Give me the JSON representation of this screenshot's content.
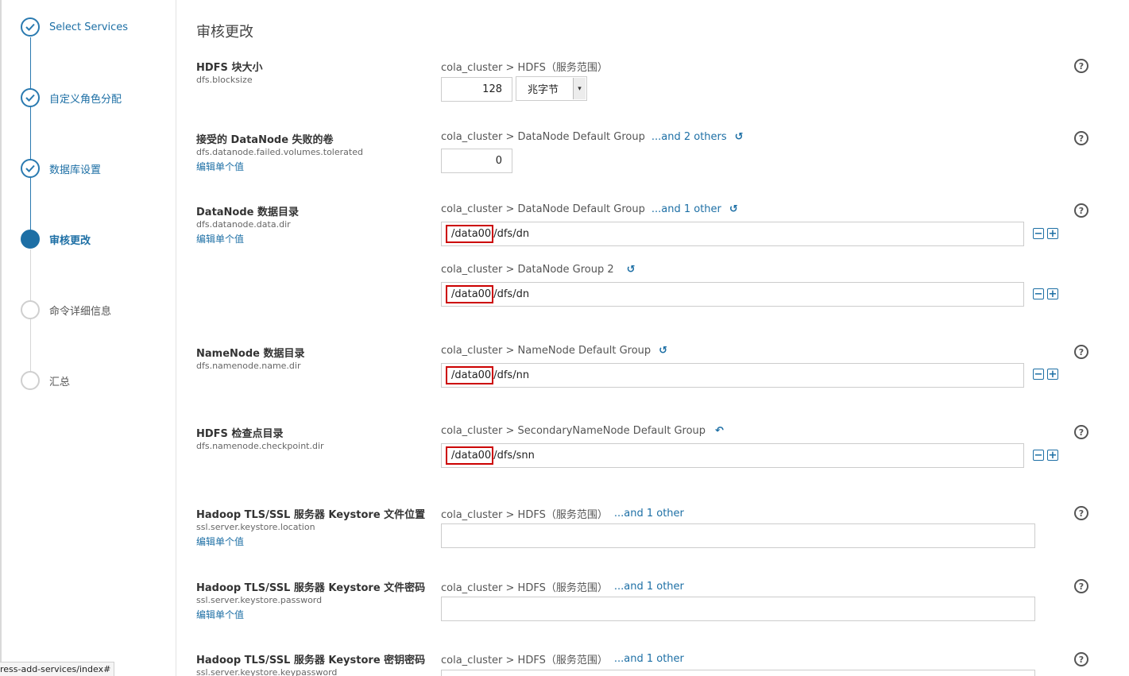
{
  "steps": [
    {
      "label": "Select Services",
      "state": "done"
    },
    {
      "label": "自定义角色分配",
      "state": "done"
    },
    {
      "label": "数据库设置",
      "state": "done"
    },
    {
      "label": "审核更改",
      "state": "active"
    },
    {
      "label": "命令详细信息",
      "state": "todo"
    },
    {
      "label": "汇总",
      "state": "todo"
    }
  ],
  "url_tip": "ress-add-services/index#",
  "page_title": "审核更改",
  "edit_label": "编辑单个值",
  "undo_icon": "↺",
  "revert_icon": "↶",
  "help_icon": "?",
  "minus_icon": "−",
  "plus_icon": "+",
  "caret_icon": "▾",
  "props": {
    "blocksize": {
      "name": "HDFS 块大小",
      "key": "dfs.blocksize",
      "scope": "cola_cluster > HDFS（服务范围）",
      "value": "128",
      "unit": "兆字节"
    },
    "failed_volumes": {
      "name": "接受的 DataNode 失败的卷",
      "key": "dfs.datanode.failed.volumes.tolerated",
      "scope": "cola_cluster > DataNode Default Group",
      "others": "...and 2 others",
      "value": "0"
    },
    "data_dir": {
      "name": "DataNode 数据目录",
      "key": "dfs.datanode.data.dir",
      "scope1": "cola_cluster > DataNode Default Group",
      "others1": "...and 1 other",
      "prefix1": "/data00",
      "rest1": "/dfs/dn",
      "scope2": "cola_cluster > DataNode Group 2",
      "prefix2": "/data00",
      "rest2": "/dfs/dn"
    },
    "name_dir": {
      "name": "NameNode 数据目录",
      "key": "dfs.namenode.name.dir",
      "scope": "cola_cluster > NameNode Default Group",
      "prefix": "/data00",
      "rest": "/dfs/nn"
    },
    "checkpoint_dir": {
      "name": "HDFS 检查点目录",
      "key": "dfs.namenode.checkpoint.dir",
      "scope": "cola_cluster > SecondaryNameNode Default Group",
      "prefix": "/data00",
      "rest": "/dfs/snn"
    },
    "keystore_location": {
      "name": "Hadoop TLS/SSL 服务器 Keystore 文件位置",
      "key": "ssl.server.keystore.location",
      "scope": "cola_cluster > HDFS（服务范围）",
      "others": "...and 1 other",
      "value": ""
    },
    "keystore_password": {
      "name": "Hadoop TLS/SSL 服务器 Keystore 文件密码",
      "key": "ssl.server.keystore.password",
      "scope": "cola_cluster > HDFS（服务范围）",
      "others": "...and 1 other",
      "value": ""
    },
    "keystore_keypassword": {
      "name": "Hadoop TLS/SSL 服务器 Keystore 密钥密码",
      "key": "ssl.server.keystore.keypassword",
      "scope": "cola_cluster > HDFS（服务范围）",
      "others": "...and 1 other"
    }
  },
  "colors": {
    "accent": "#1d6fa5",
    "highlight": "#cc0000"
  }
}
